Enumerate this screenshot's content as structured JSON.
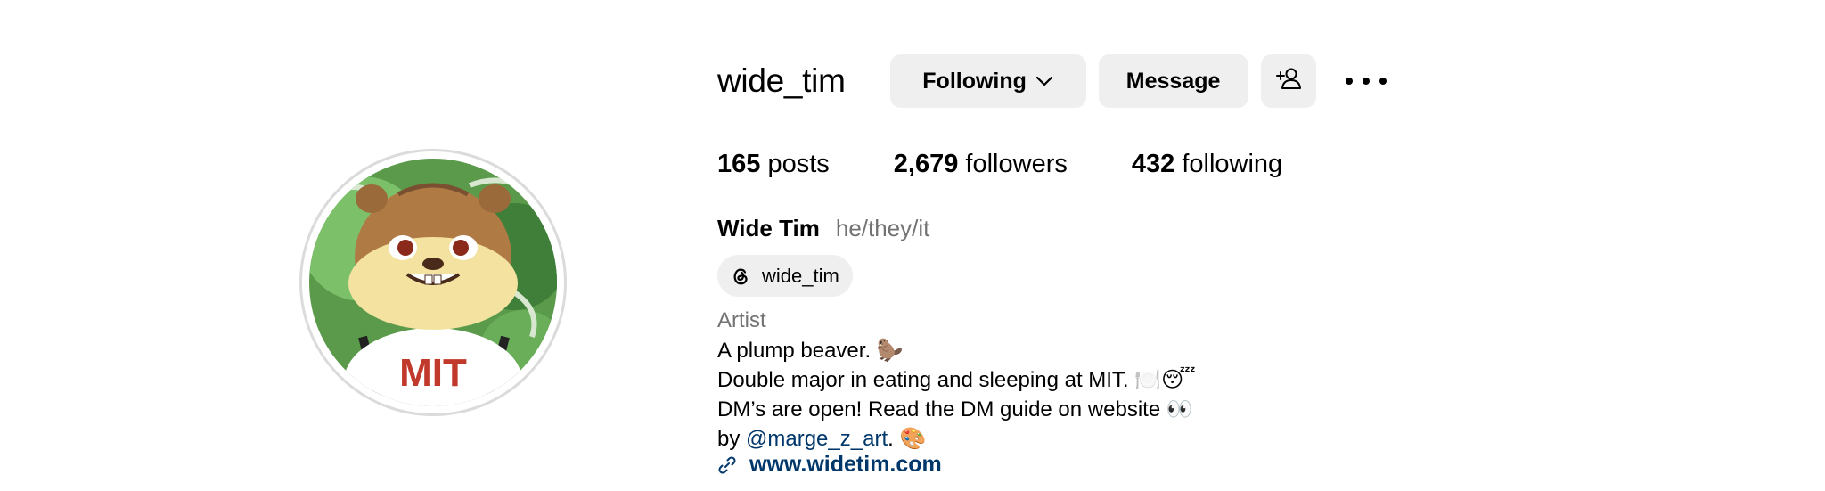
{
  "profile": {
    "username": "wide_tim",
    "display_name": "Wide Tim",
    "pronouns": "he/they/it",
    "threads_handle": "wide_tim",
    "category": "Artist"
  },
  "actions": {
    "following_label": "Following",
    "message_label": "Message"
  },
  "stats": {
    "posts_count": "165",
    "posts_label": "posts",
    "followers_count": "2,679",
    "followers_label": "followers",
    "following_count": "432",
    "following_label": "following"
  },
  "bio": {
    "line1": "A plump beaver. 🦫",
    "line2": "Double major in eating and sleeping at MIT. 🍽️😴",
    "line3": "DM’s are open! Read the DM guide on website 👀",
    "line4_prefix": "by ",
    "line4_mention": "@marge_z_art",
    "line4_suffix": ". 🎨",
    "website": "www.widetim.com"
  },
  "avatar": {
    "shirt_text": "MIT"
  },
  "icons": {
    "following_chevron": "chevron-down-icon",
    "suggest": "add-person-icon",
    "more": "more-options-icon",
    "threads": "threads-icon",
    "link": "link-icon"
  },
  "colors": {
    "button_bg": "#efefef",
    "link": "#00376b",
    "secondary_text": "#737373",
    "avatar_ring": "#dbdbdb"
  }
}
